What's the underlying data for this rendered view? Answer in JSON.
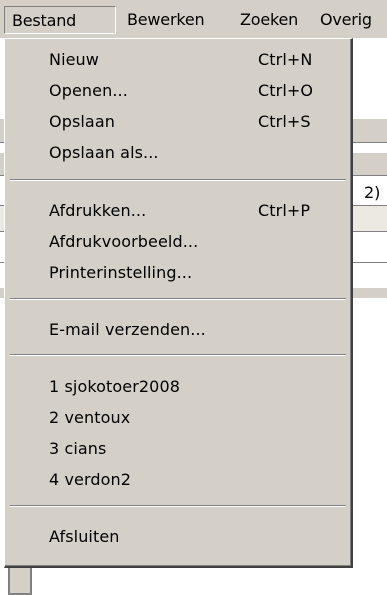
{
  "menubar": {
    "bestand": "Bestand",
    "bewerken": "Bewerken",
    "zoeken": "Zoeken",
    "overig": "Overig"
  },
  "background": {
    "fragment_text": "2)"
  },
  "menu": {
    "nieuw": {
      "label": "Nieuw",
      "shortcut": "Ctrl+N"
    },
    "openen": {
      "label": "Openen...",
      "shortcut": "Ctrl+O"
    },
    "opslaan": {
      "label": "Opslaan",
      "shortcut": "Ctrl+S"
    },
    "opslaan_als": {
      "label": "Opslaan als..."
    },
    "afdrukken": {
      "label": "Afdrukken...",
      "shortcut": "Ctrl+P"
    },
    "afdrukvoorbeeld": {
      "label": "Afdrukvoorbeeld..."
    },
    "printerinstelling": {
      "label": "Printerinstelling..."
    },
    "email": {
      "label": "E-mail verzenden..."
    },
    "recent": [
      {
        "label": "1 sjokotoer2008"
      },
      {
        "label": "2 ventoux"
      },
      {
        "label": "3 cians"
      },
      {
        "label": "4 verdon2"
      }
    ],
    "afsluiten": {
      "label": "Afsluiten"
    }
  }
}
